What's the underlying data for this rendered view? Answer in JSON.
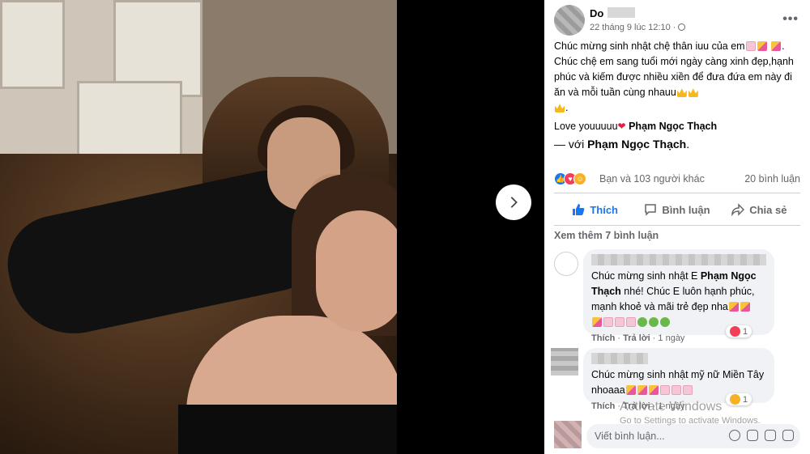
{
  "post": {
    "author": "Do",
    "time": "22 tháng 9 lúc 12:10 ·",
    "caption_line1": "Chúc mừng sinh nhật chệ thân iuu của em",
    "caption_line2": ". Chúc chệ em sang tuổi mới ngày càng xinh đẹp,hạnh phúc và kiếm được nhiều xiền để đưa đứa em này đi ăn và mỗi tuần cùng nhauu",
    "caption_line3": ".",
    "love_text": "Love youuuuu",
    "mention": "Phạm Ngọc Thạch",
    "with_prefix": "— với",
    "with_name": "Phạm Ngọc Thạch",
    "with_suffix": "."
  },
  "reactions": {
    "text": "Bạn và 103 người khác",
    "comments": "20 bình luận"
  },
  "actions": {
    "like": "Thích",
    "comment": "Bình luận",
    "share": "Chia sẻ"
  },
  "more_comments": "Xem thêm 7 bình luận",
  "comments": [
    {
      "text_prefix": "Chúc mừng sinh nhật E",
      "mention": "Phạm Ngọc Thạch",
      "text_suffix": "nhé! Chúc E luôn hạnh phúc, mạnh khoẻ và mãi trẻ đẹp nha",
      "like": "Thích",
      "reply": "Trả lời",
      "time": "1 ngày",
      "react_count": "1"
    },
    {
      "text": "Chúc mừng sinh nhật mỹ nữ Miền Tây nhoaaa",
      "like": "Thích",
      "reply": "Trả lời",
      "time": "1 ngày",
      "react_count": "1"
    }
  ],
  "write_comment": {
    "placeholder": "Viết bình luận..."
  },
  "watermark": {
    "line1": "Activate Windows",
    "line2": "Go to Settings to activate Windows."
  },
  "colors": {
    "accent": "#1877f2",
    "love": "#f33e58",
    "haha": "#f7b125",
    "text_secondary": "#65676b"
  },
  "icons": {
    "next": "chevron-right-icon",
    "more": "more-options-icon",
    "like": "thumbs-up-icon",
    "comment": "comment-bubble-icon",
    "share": "share-arrow-icon"
  }
}
